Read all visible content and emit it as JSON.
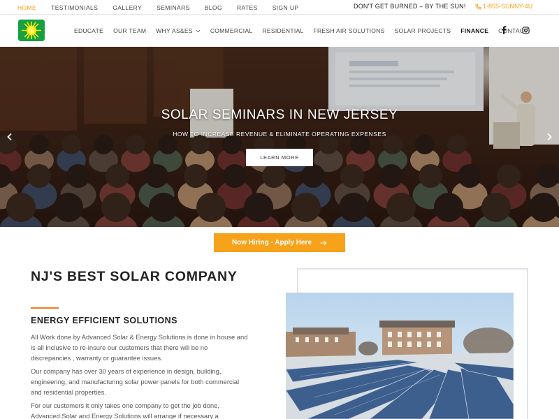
{
  "topbar": {
    "nav": [
      {
        "label": "HOME",
        "active": true
      },
      {
        "label": "TESTIMONIALS",
        "active": false
      },
      {
        "label": "GALLERY",
        "active": false
      },
      {
        "label": "SEMINARS",
        "active": false
      },
      {
        "label": "BLOG",
        "active": false
      },
      {
        "label": "RATES",
        "active": false
      },
      {
        "label": "SIGN UP",
        "active": false
      }
    ],
    "tagline": "DON'T GET BURNED – BY THE SUN!",
    "phone": "1-855-SUNNY-4U"
  },
  "header": {
    "logo_icon": "sun-logo-icon",
    "nav": [
      {
        "label": "EDUCATE"
      },
      {
        "label": "OUR TEAM"
      },
      {
        "label": "WHY AS&ES",
        "dropdown": true
      },
      {
        "label": "COMMERCIAL"
      },
      {
        "label": "RESIDENTIAL"
      },
      {
        "label": "FRESH AIR SOLUTIONS"
      },
      {
        "label": "SOLAR PROJECTS"
      },
      {
        "label": "FINANCE",
        "bold": true
      },
      {
        "label": "CONTACT"
      }
    ],
    "social": [
      "facebook-icon",
      "instagram-icon"
    ]
  },
  "hero": {
    "title": "SOLAR SEMINARS IN NEW JERSEY",
    "subtitle": "HOW TO INCREASE REVENUE & ELIMINATE OPERATING EXPENSES",
    "button": "LEARN MORE"
  },
  "hiring": {
    "label": "Now Hiring - Apply Here"
  },
  "content": {
    "title": "NJ'S BEST SOLAR COMPANY",
    "subtitle": "ENERGY EFFICIENT SOLUTIONS",
    "paragraphs": [
      "All Work done by Advanced Solar & Energy Solutions is done in house and is all inclusive to re-insure our customers that there will be no discrepancies , warranty or guarantee issues.",
      "Our company has over 30 years of experience in design, building, engineering, and manufacturing solar power panels for both commercial and residential properties.",
      "For our customers it only takes one company to get the job done, Advanced Solar and Energy Solutions will arrange if necessary a"
    ]
  },
  "colors": {
    "accent": "#f4a11a",
    "button_orange": "#f6a21b",
    "title_bar": "#f07c1b"
  }
}
